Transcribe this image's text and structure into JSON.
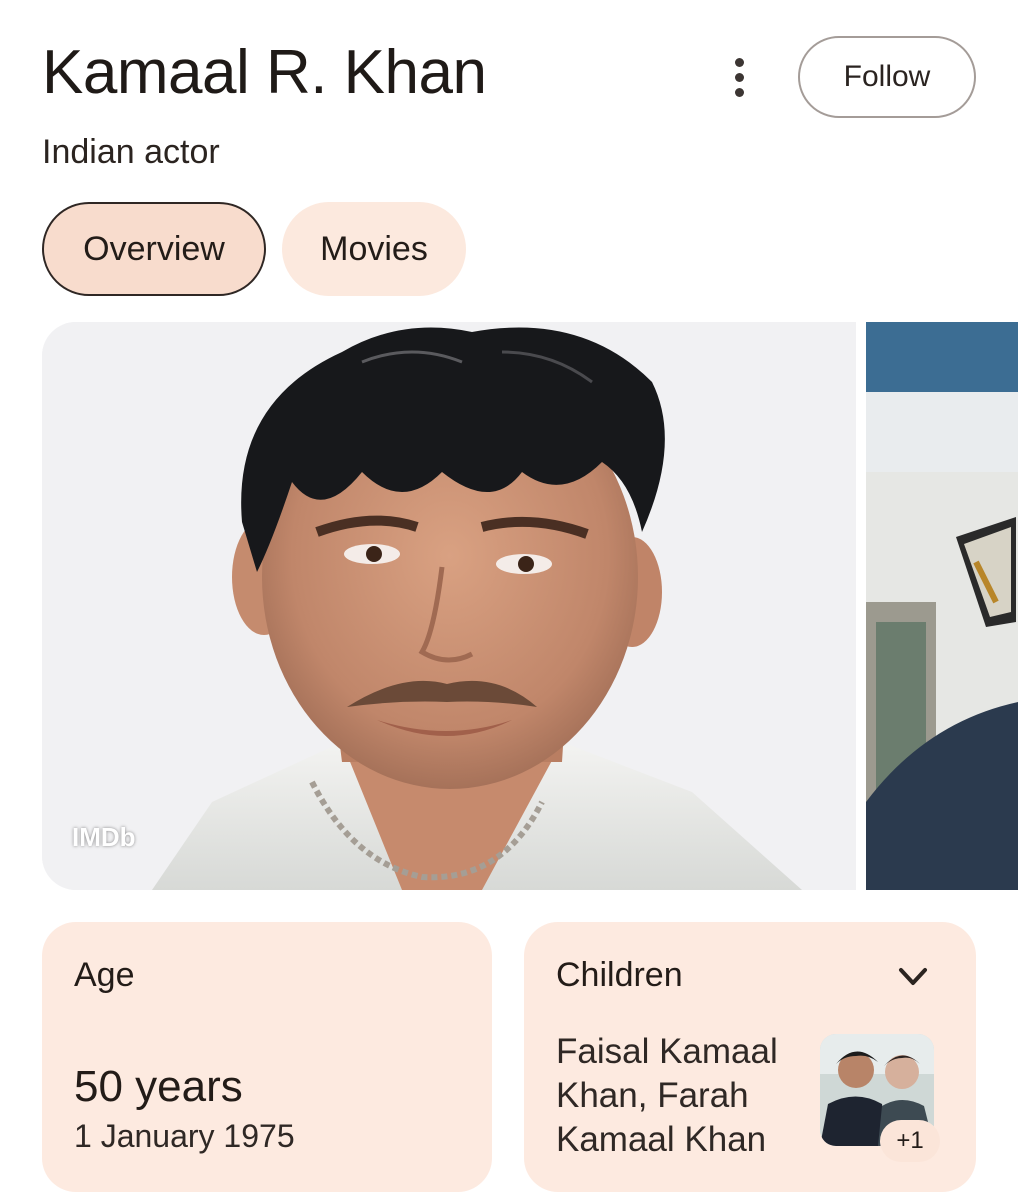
{
  "header": {
    "title": "Kamaal R. Khan",
    "subtitle": "Indian actor",
    "follow_label": "Follow",
    "more_icon": "more-vert-icon"
  },
  "tabs": [
    {
      "label": "Overview",
      "selected": true
    },
    {
      "label": "Movies",
      "selected": false
    }
  ],
  "images": {
    "main_source": "IMDb"
  },
  "cards": {
    "age": {
      "label": "Age",
      "value": "50 years",
      "date": "1 January 1975"
    },
    "children": {
      "label": "Children",
      "names": "Faisal Kamaal Khan, Farah Kamaal Khan",
      "more_count": "+1",
      "expand_icon": "chevron-down-icon"
    }
  },
  "colors": {
    "tab_selected_bg": "#f8dccd",
    "tab_bg": "#fce9de",
    "card_bg": "#fdeae0",
    "text_primary": "#1f1a17"
  }
}
